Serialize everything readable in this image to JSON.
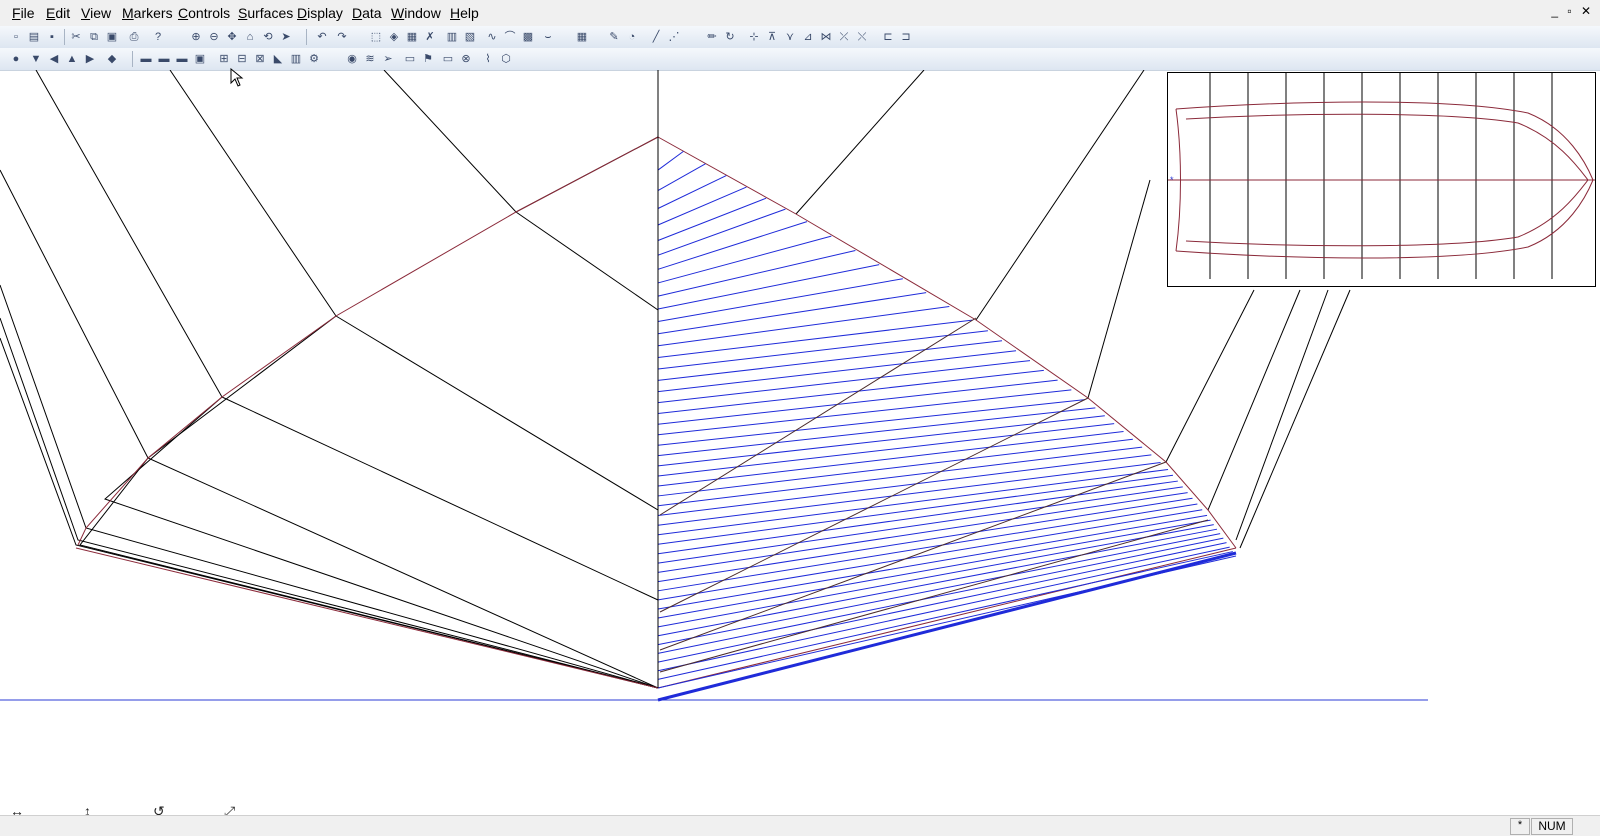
{
  "menu": {
    "items": [
      "File",
      "Edit",
      "View",
      "Markers",
      "Controls",
      "Surfaces",
      "Display",
      "Data",
      "Window",
      "Help"
    ]
  },
  "window_controls": "_ ▫ ✕",
  "statusbar": {
    "indicator": "*",
    "num": "NUM"
  },
  "nav_icons": [
    "↔",
    "↕",
    "↺",
    "⤢"
  ],
  "colors": {
    "hull_lines": "#000000",
    "maroon_lines": "#8b2a3a",
    "station_lines": "#1f2bd9",
    "baseline": "#2b3bd6"
  }
}
